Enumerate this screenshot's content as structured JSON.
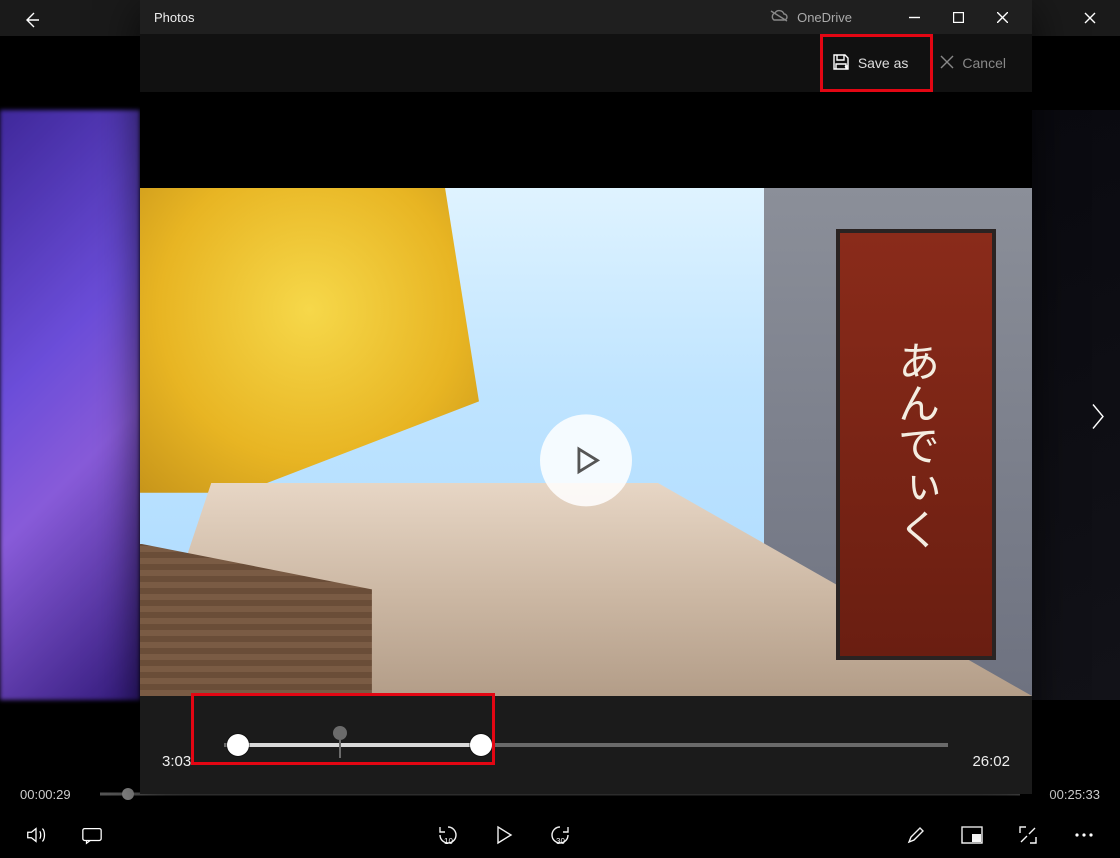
{
  "outer": {
    "current_time": "00:00:29",
    "total_time": "00:25:33",
    "timeline_progress_pct": 3.0
  },
  "modal": {
    "app_title": "Photos",
    "cloud_label": "OneDrive",
    "save_label": "Save as",
    "cancel_label": "Cancel",
    "sign_text": "あんでぃく",
    "trim": {
      "start_label": "3:03",
      "end_label": "26:02",
      "sel_start_pct": 2.0,
      "sel_end_pct": 35.5,
      "playhead_pct": 16.0
    }
  },
  "icons": {
    "back": "back-arrow-icon",
    "close": "close-icon",
    "cloud_off": "cloud-off-icon",
    "save": "save-as-icon",
    "minimize": "minimize-icon",
    "maximize": "maximize-icon",
    "play": "play-icon",
    "volume": "volume-icon",
    "subtitles": "subtitles-icon",
    "skip_back": "skip-back-10-icon",
    "skip_fwd": "skip-fwd-30-icon",
    "pencil": "pencil-icon",
    "pip": "mini-view-icon",
    "fullscreen": "fullscreen-icon",
    "more": "more-icon",
    "next": "chevron-right-icon"
  }
}
